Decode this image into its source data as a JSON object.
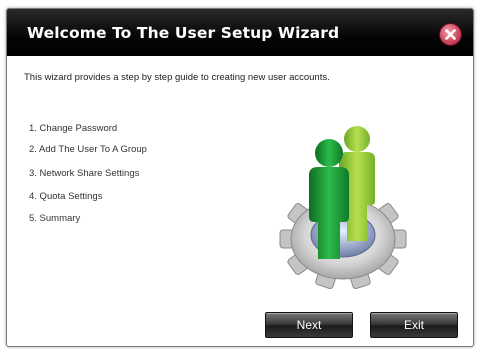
{
  "window": {
    "title": "Welcome To The User Setup Wizard"
  },
  "intro": "This wizard provides a step by step guide to creating new user accounts.",
  "steps": [
    "1. Change Password",
    "2. Add The User To A Group",
    "3. Network Share Settings",
    "4. Quota Settings",
    "5. Summary"
  ],
  "buttons": {
    "next": "Next",
    "exit": "Exit"
  },
  "icons": {
    "close": "close-icon",
    "illustration": "users-gear-icon"
  },
  "colors": {
    "titlebar": "#000000",
    "close": "#d04860",
    "user_front": "#1e9a3a",
    "user_back": "#8cc63f"
  }
}
